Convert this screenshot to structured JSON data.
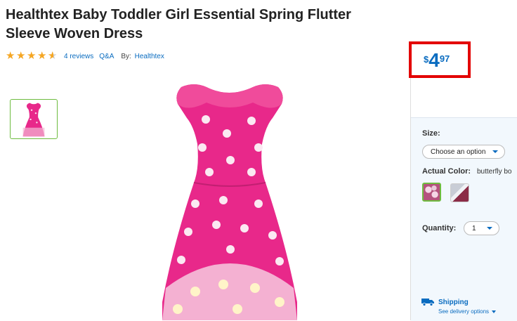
{
  "product": {
    "title": "Healthtex Baby Toddler Girl Essential Spring Flutter Sleeve Woven Dress",
    "rating": 4.5,
    "reviews_text": "4 reviews",
    "qa_text": "Q&A",
    "by_label": "By:",
    "brand": "Healthtex"
  },
  "price": {
    "currency": "$",
    "dollars": "4",
    "cents": "97"
  },
  "options": {
    "size_label": "Size:",
    "size_placeholder": "Choose an option",
    "color_label": "Actual Color:",
    "color_value": "butterfly bo",
    "quantity_label": "Quantity:",
    "quantity_value": "1"
  },
  "shipping": {
    "title": "Shipping",
    "subtitle": "See delivery options"
  },
  "colors": {
    "accent": "#0a6cc0",
    "price_highlight": "#e30000",
    "dress": "#e8288a",
    "selected": "#6ebc3f"
  }
}
